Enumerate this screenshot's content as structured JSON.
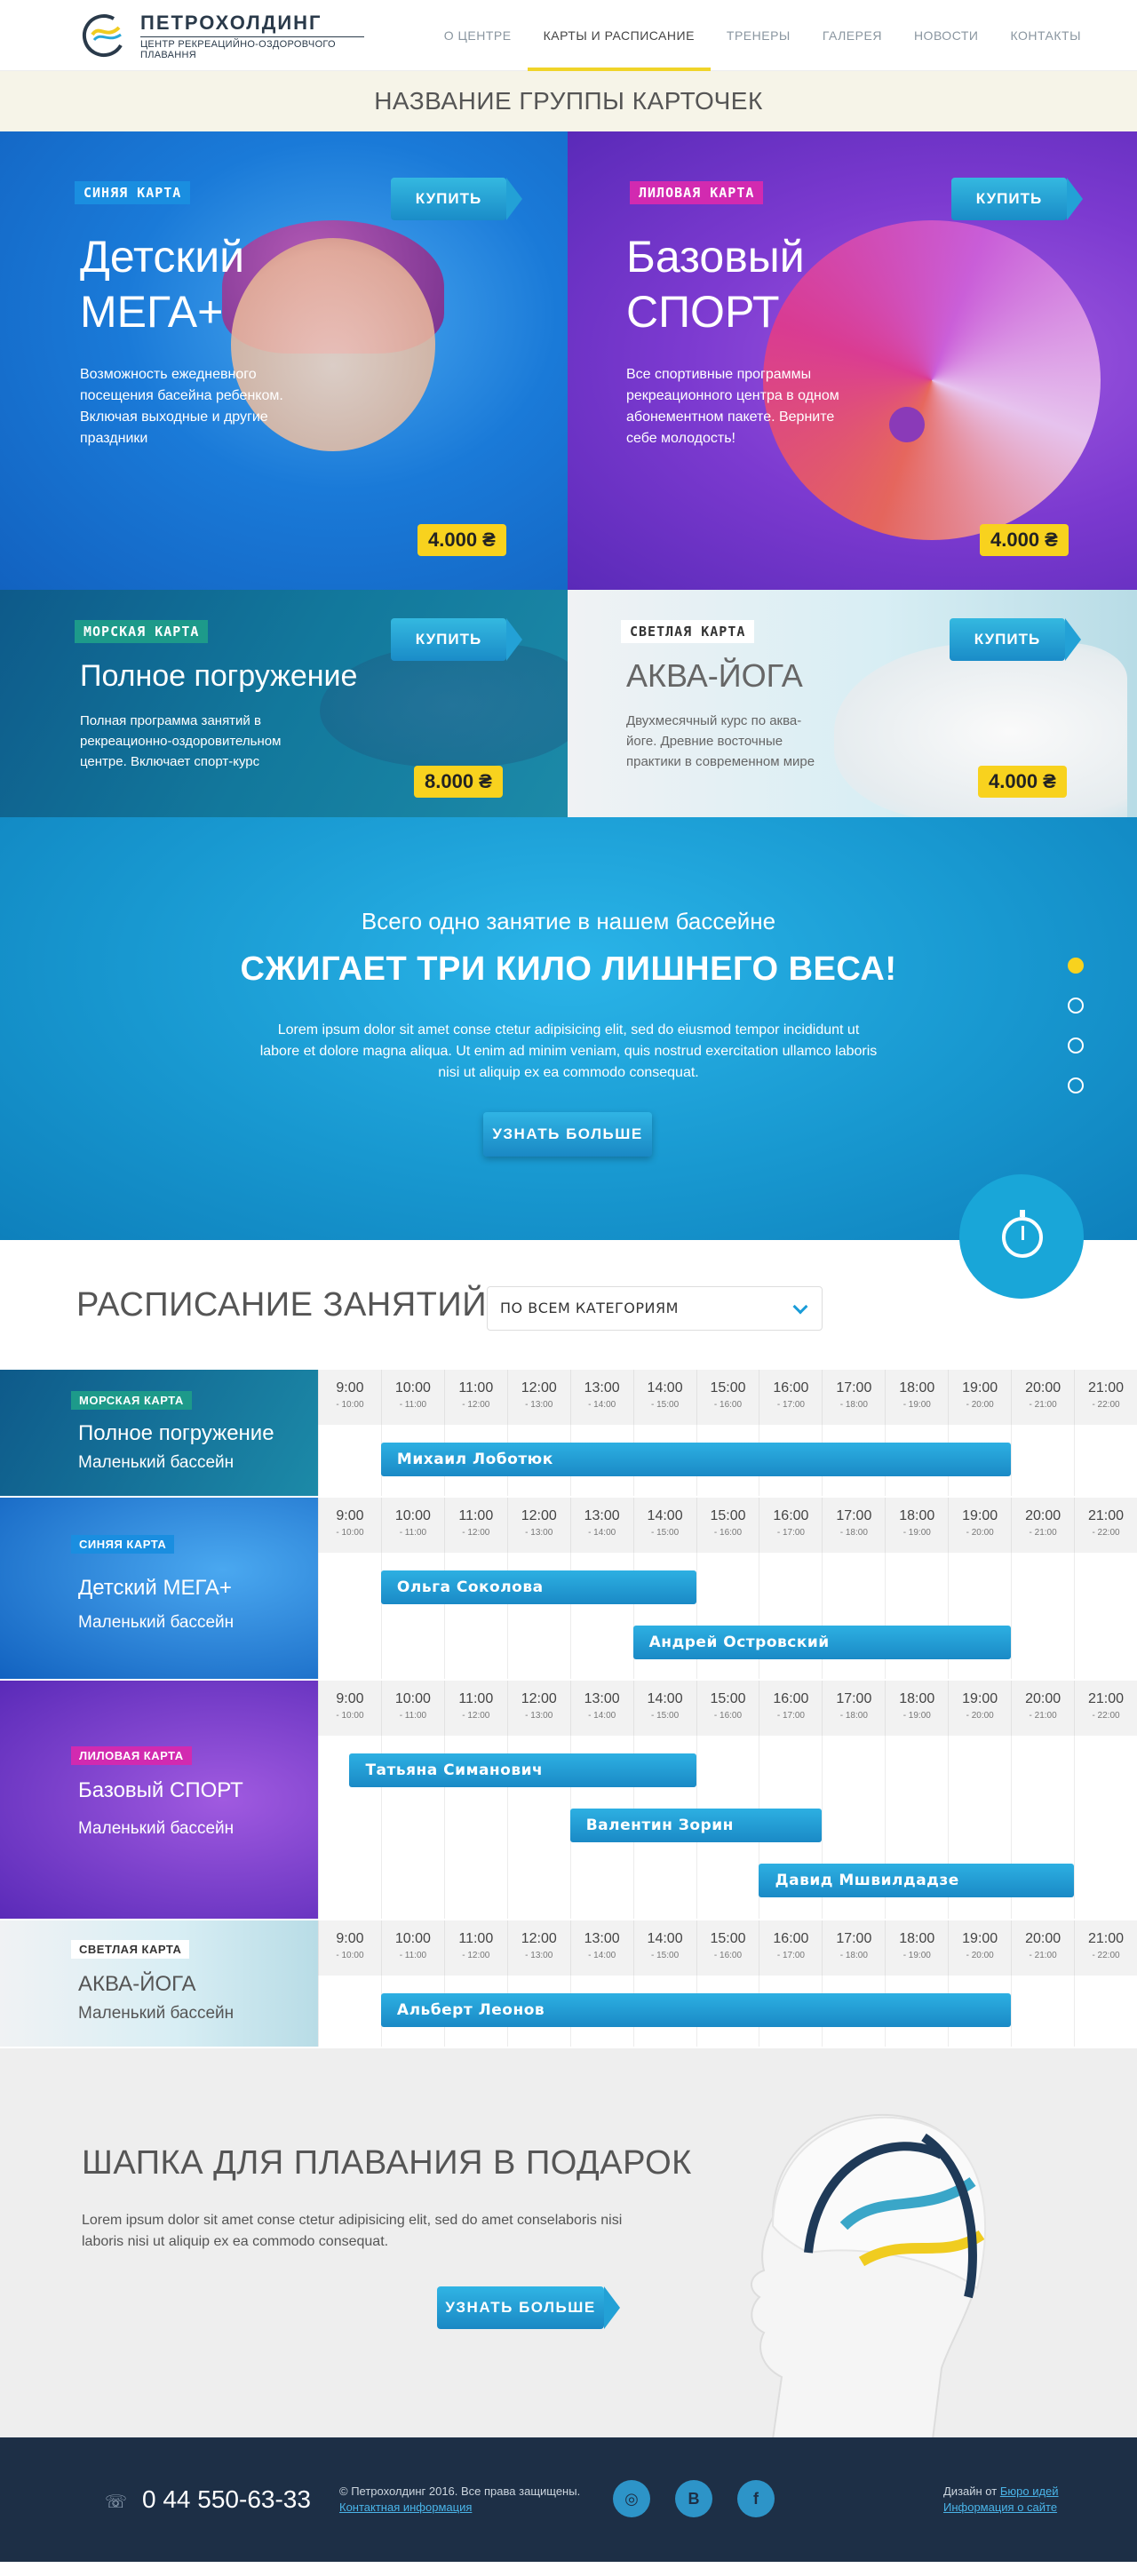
{
  "header": {
    "logo_name": "ПЕТРОХОЛДИНГ",
    "logo_sub": "ЦЕНТР РЕКРЕАЦИЙНО-ОЗДОРОВЧОГО ПЛАВАННЯ",
    "nav": [
      {
        "label": "О центре"
      },
      {
        "label": "Карты и расписание",
        "active": true
      },
      {
        "label": "Тренеры"
      },
      {
        "label": "Галерея"
      },
      {
        "label": "Новости"
      },
      {
        "label": "Контакты"
      }
    ]
  },
  "group_title": "НАЗВАНИЕ ГРУППЫ КАРТОЧЕК",
  "cards": [
    {
      "badge": "СИНЯЯ КАРТА",
      "badge_bg": "#1a8ee0",
      "badge_color": "#ffffff",
      "title_line1": "Детский",
      "title_line2": "МЕГА+",
      "desc": "Возможность ежедневного посещения басейна ребенком. Включая выходные и другие праздники",
      "buy": "КУПИТЬ",
      "price": "4.000 ₴"
    },
    {
      "badge": "ЛИЛОВАЯ КАРТА",
      "badge_bg": "#d22ab0",
      "badge_color": "#ffffff",
      "title_line1": "Базовый",
      "title_line2": "СПОРТ",
      "desc": "Все спортивные программы рекреационного центра в одном абонементном пакете. Верните себе молодость!",
      "buy": "КУПИТЬ",
      "price": "4.000 ₴"
    },
    {
      "badge": "МОРСКАЯ КАРТА",
      "badge_bg": "#1d9a8a",
      "badge_color": "#ffffff",
      "title": "Полное погружение",
      "desc": "Полная программа занятий в рекреационно-оздоровительном центре. Включает спорт-курс",
      "buy": "КУПИТЬ",
      "price": "8.000 ₴"
    },
    {
      "badge": "СВЕТЛАЯ КАРТА",
      "badge_bg": "#ffffff",
      "badge_color": "#333333",
      "title": "АКВА-ЙОГА",
      "desc": "Двухмесячный курс по аква-йоге. Древние восточные практики в современном мире",
      "buy": "КУПИТЬ",
      "price": "4.000 ₴"
    }
  ],
  "promo": {
    "pre": "Всего одно занятие в нашем бассейне",
    "title": "СЖИГАЕТ ТРИ КИЛО ЛИШНЕГО ВЕСА!",
    "text": "Lorem ipsum dolor sit amet conse ctetur adipisicing elit, sed do eiusmod tempor incididunt ut labore et dolore magna aliqua. Ut enim ad minim veniam, quis nostrud exercitation ullamco laboris nisi ut aliquip ex ea commodo consequat.",
    "button": "УЗНАТЬ БОЛЬШЕ",
    "slide_count": 4,
    "active_slide": 1
  },
  "schedule": {
    "title": "РАСПИСАНИЕ ЗАНЯТИЙ",
    "filter": "ПО ВСЕМ КАТЕГОРИЯМ",
    "times": [
      {
        "t": "9:00",
        "s": "- 10:00"
      },
      {
        "t": "10:00",
        "s": "- 11:00"
      },
      {
        "t": "11:00",
        "s": "- 12:00"
      },
      {
        "t": "12:00",
        "s": "- 13:00"
      },
      {
        "t": "13:00",
        "s": "- 14:00"
      },
      {
        "t": "14:00",
        "s": "- 15:00"
      },
      {
        "t": "15:00",
        "s": "- 16:00"
      },
      {
        "t": "16:00",
        "s": "- 17:00"
      },
      {
        "t": "17:00",
        "s": "- 18:00"
      },
      {
        "t": "18:00",
        "s": "- 19:00"
      },
      {
        "t": "19:00",
        "s": "- 20:00"
      },
      {
        "t": "20:00",
        "s": "- 21:00"
      },
      {
        "t": "21:00",
        "s": "- 22:00"
      }
    ],
    "rows": [
      {
        "badge": "МОРСКАЯ КАРТА",
        "title": "Полное погружение",
        "pool": "Маленький бассейн",
        "lessons": [
          {
            "name": "Михаил Лоботюк",
            "start": 1,
            "end": 11
          }
        ]
      },
      {
        "badge": "СИНЯЯ КАРТА",
        "title": "Детский МЕГА+",
        "pool": "Маленький бассейн",
        "lessons": [
          {
            "name": "Ольга Соколова",
            "start": 1,
            "end": 6
          },
          {
            "name": "Андрей Островский",
            "start": 5,
            "end": 11
          }
        ]
      },
      {
        "badge": "ЛИЛОВАЯ КАРТА",
        "title": "Базовый СПОРТ",
        "pool": "Маленький бассейн",
        "lessons": [
          {
            "name": "Татьяна Симанович",
            "start": 0.5,
            "end": 6
          },
          {
            "name": "Валентин Зорин",
            "start": 4,
            "end": 8
          },
          {
            "name": "Давид Мшвилдадзе",
            "start": 7,
            "end": 12
          }
        ]
      },
      {
        "badge": "СВЕТЛАЯ КАРТА",
        "title": "АКВА-ЙОГА",
        "pool": "Маленький бассейн",
        "lessons": [
          {
            "name": "Альберт Леонов",
            "start": 1,
            "end": 11
          }
        ]
      }
    ]
  },
  "gift": {
    "title": "ШАПКА ДЛЯ ПЛАВАНИЯ В ПОДАРОК",
    "text": "Lorem ipsum dolor sit amet conse ctetur adipisicing elit, sed do amet conselaboris nisi laboris nisi ut aliquip ex ea commodo consequat.",
    "button": "УЗНАТЬ БОЛЬШЕ"
  },
  "footer": {
    "phone": "0 44 550-63-33",
    "copyright": "© Петрохолдинг 2016. Все права защищены.",
    "contact_link": "Контактная информация",
    "socials": [
      "instagram-icon",
      "vk-icon",
      "facebook-icon"
    ],
    "design_by": "Дизайн от",
    "design_link": "Бюро идей",
    "design_info_link": "Информация о сайте"
  }
}
